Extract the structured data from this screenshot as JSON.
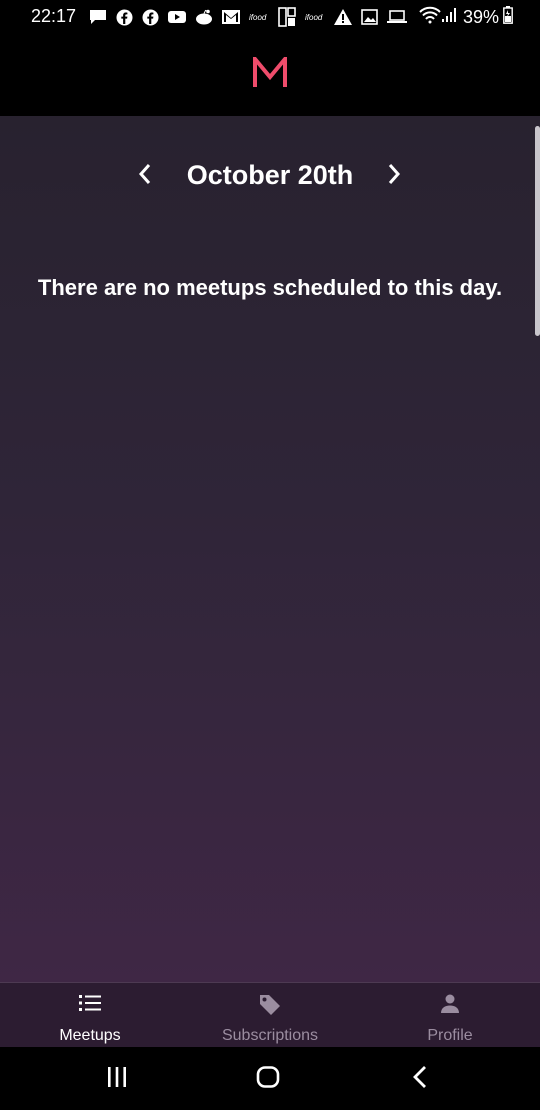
{
  "status_bar": {
    "time": "22:17",
    "battery": "39%",
    "notification_icons": [
      "message-icon",
      "facebook-icon",
      "facebook-icon",
      "youtube-icon",
      "reddit-icon",
      "gmail-icon",
      "ifood-icon",
      "app-icon",
      "ifood-icon",
      "warning-icon",
      "image-icon",
      "laptop-icon"
    ]
  },
  "header": {
    "logo_letter": "M",
    "logo_color": "#ef4c6b"
  },
  "date_nav": {
    "title": "October 20th"
  },
  "main": {
    "empty_message": "There are no meetups scheduled to this day."
  },
  "bottom_nav": {
    "tabs": [
      {
        "label": "Meetups",
        "icon": "list-icon",
        "active": true
      },
      {
        "label": "Subscriptions",
        "icon": "tag-icon",
        "active": false
      },
      {
        "label": "Profile",
        "icon": "person-icon",
        "active": false
      }
    ]
  },
  "colors": {
    "accent": "#ef4c6b",
    "tab_active": "#ffffff",
    "tab_inactive": "#9b8da0"
  }
}
